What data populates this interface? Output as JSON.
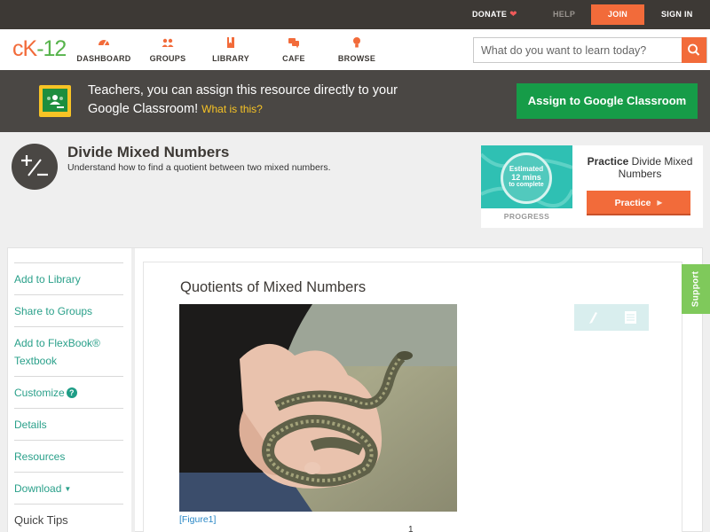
{
  "topbar": {
    "donate": "DONATE",
    "help": "HELP",
    "join": "JOIN",
    "signin": "SIGN IN"
  },
  "logo": {
    "ck": "cK",
    "dash": "-",
    "num": "12"
  },
  "nav": {
    "items": [
      {
        "label": "DASHBOARD",
        "icon": "dashboard-icon"
      },
      {
        "label": "GROUPS",
        "icon": "groups-icon"
      },
      {
        "label": "LIBRARY",
        "icon": "library-icon"
      },
      {
        "label": "CAFE",
        "icon": "cafe-icon"
      },
      {
        "label": "BROWSE",
        "icon": "browse-icon"
      }
    ],
    "search_placeholder": "What do you want to learn today?"
  },
  "banner": {
    "text": "Teachers, you can assign this resource directly to your Google Classroom!",
    "what": "What is this?",
    "assign_label": "Assign to Google Classroom"
  },
  "concept": {
    "title": "Divide Mixed Numbers",
    "subtitle": "Understand how to find a quotient between two mixed numbers."
  },
  "practice": {
    "estimated": "Estimated",
    "mins": "12 mins",
    "to_complete": "to complete",
    "progress_label": "PROGRESS",
    "title_bold": "Practice",
    "title_rest": "Divide Mixed Numbers",
    "button": "Practice"
  },
  "sidebar": {
    "items": [
      {
        "label": "Add to Library"
      },
      {
        "label": "Share to Groups"
      },
      {
        "label": "Add to FlexBook® Textbook"
      },
      {
        "label": "Customize"
      },
      {
        "label": "Details"
      },
      {
        "label": "Resources"
      },
      {
        "label": "Download"
      }
    ],
    "customize_badge": "?",
    "quick_tips": "Quick Tips"
  },
  "content": {
    "title": "Quotients of Mixed Numbers",
    "figure_caption": "[Figure1]",
    "figure_number": "1"
  },
  "support": {
    "label": "Support"
  },
  "colors": {
    "brand_orange": "#f26b3a",
    "brand_green": "#56b34b",
    "classroom_green": "#169c48",
    "link_teal": "#2aa08a"
  }
}
